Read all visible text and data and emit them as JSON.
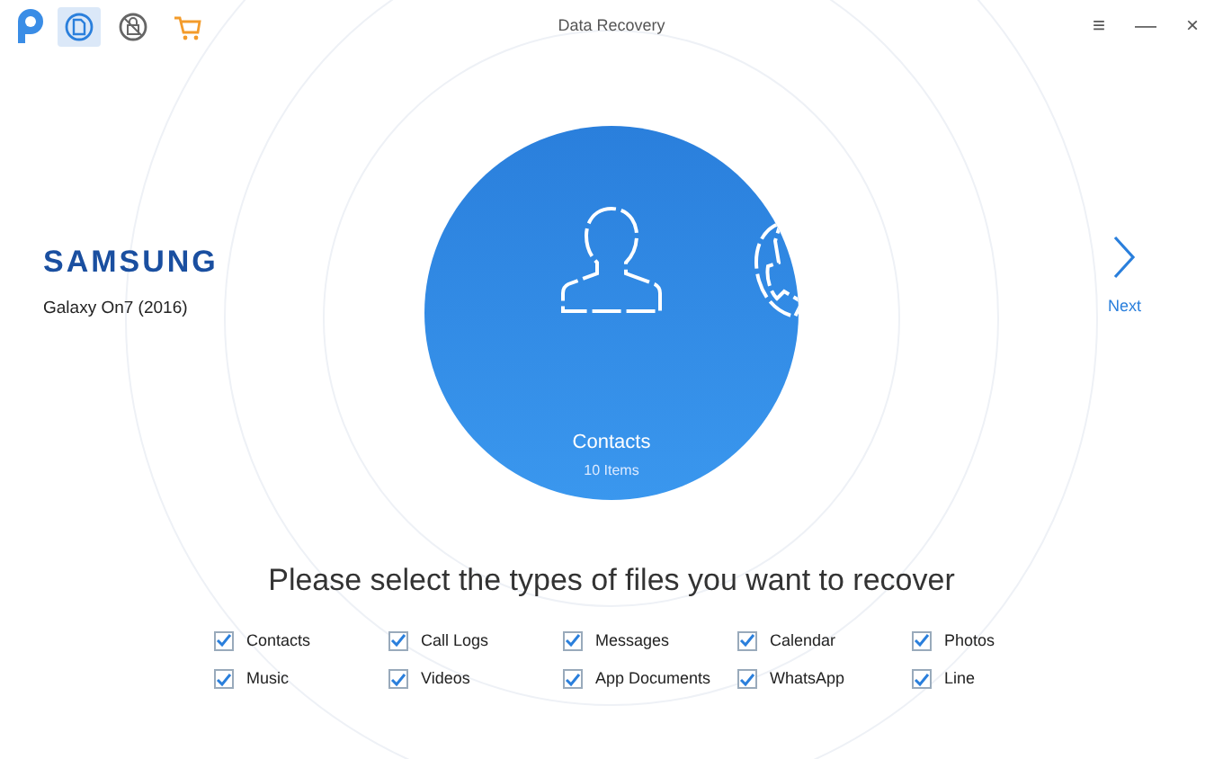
{
  "window": {
    "title": "Data Recovery",
    "controls": [
      "≡",
      "—",
      "×"
    ]
  },
  "toolbar": [
    {
      "kind": "recovery",
      "selected": true
    },
    {
      "kind": "unlock",
      "selected": false
    },
    {
      "kind": "cart",
      "selected": false
    }
  ],
  "device": {
    "brand": "SAMSUNG",
    "model": "Galaxy On7 (2016)"
  },
  "carousel": {
    "current": {
      "label": "Contacts",
      "count": "10 Items"
    }
  },
  "next": {
    "label": "Next"
  },
  "prompt": "Please select the types of files you want to recover",
  "file_types": [
    {
      "label": "Contacts",
      "checked": true
    },
    {
      "label": "Call Logs",
      "checked": true
    },
    {
      "label": "Messages",
      "checked": true
    },
    {
      "label": "Calendar",
      "checked": true
    },
    {
      "label": "Photos",
      "checked": true
    },
    {
      "label": "Music",
      "checked": true
    },
    {
      "label": "Videos",
      "checked": true
    },
    {
      "label": "App Documents",
      "checked": true
    },
    {
      "label": "WhatsApp",
      "checked": true
    },
    {
      "label": "Line",
      "checked": true
    }
  ]
}
